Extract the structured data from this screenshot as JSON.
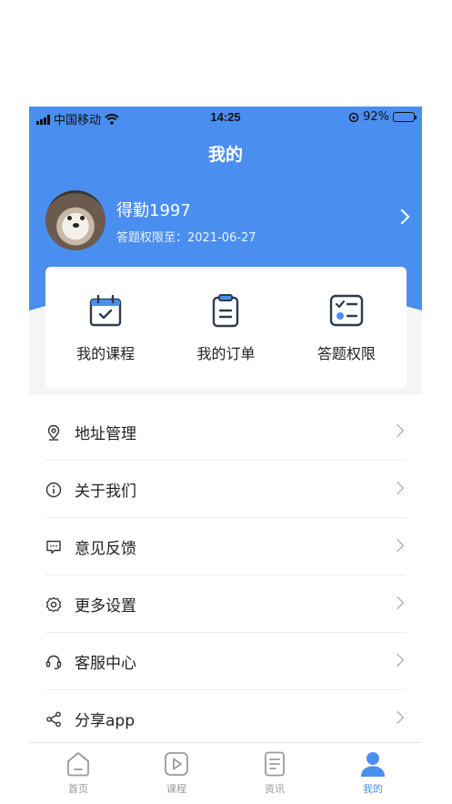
{
  "status_bar": {
    "carrier": "中国移动",
    "time": "14:25",
    "battery": "92%",
    "battery_level": 0.92
  },
  "header": {
    "title": "我的"
  },
  "profile": {
    "username": "得勤1997",
    "expire_text": "答题权限至：2021-06-27"
  },
  "quick_actions": [
    {
      "label": "我的课程",
      "icon": "calendar-check-icon"
    },
    {
      "label": "我的订单",
      "icon": "clipboard-icon"
    },
    {
      "label": "答题权限",
      "icon": "checklist-icon"
    }
  ],
  "menu": [
    {
      "label": "地址管理",
      "icon": "location-pin-icon"
    },
    {
      "label": "关于我们",
      "icon": "info-icon"
    },
    {
      "label": "意见反馈",
      "icon": "feedback-icon"
    },
    {
      "label": "更多设置",
      "icon": "gear-icon"
    },
    {
      "label": "客服中心",
      "icon": "headset-icon"
    },
    {
      "label": "分享app",
      "icon": "share-icon"
    }
  ],
  "tabbar": [
    {
      "label": "首页",
      "icon": "home-icon",
      "active": false
    },
    {
      "label": "课程",
      "icon": "play-icon",
      "active": false
    },
    {
      "label": "资讯",
      "icon": "document-icon",
      "active": false
    },
    {
      "label": "我的",
      "icon": "user-icon",
      "active": true
    }
  ],
  "colors": {
    "accent": "#4a8ef0",
    "icon_dark": "#2f3a4a"
  }
}
